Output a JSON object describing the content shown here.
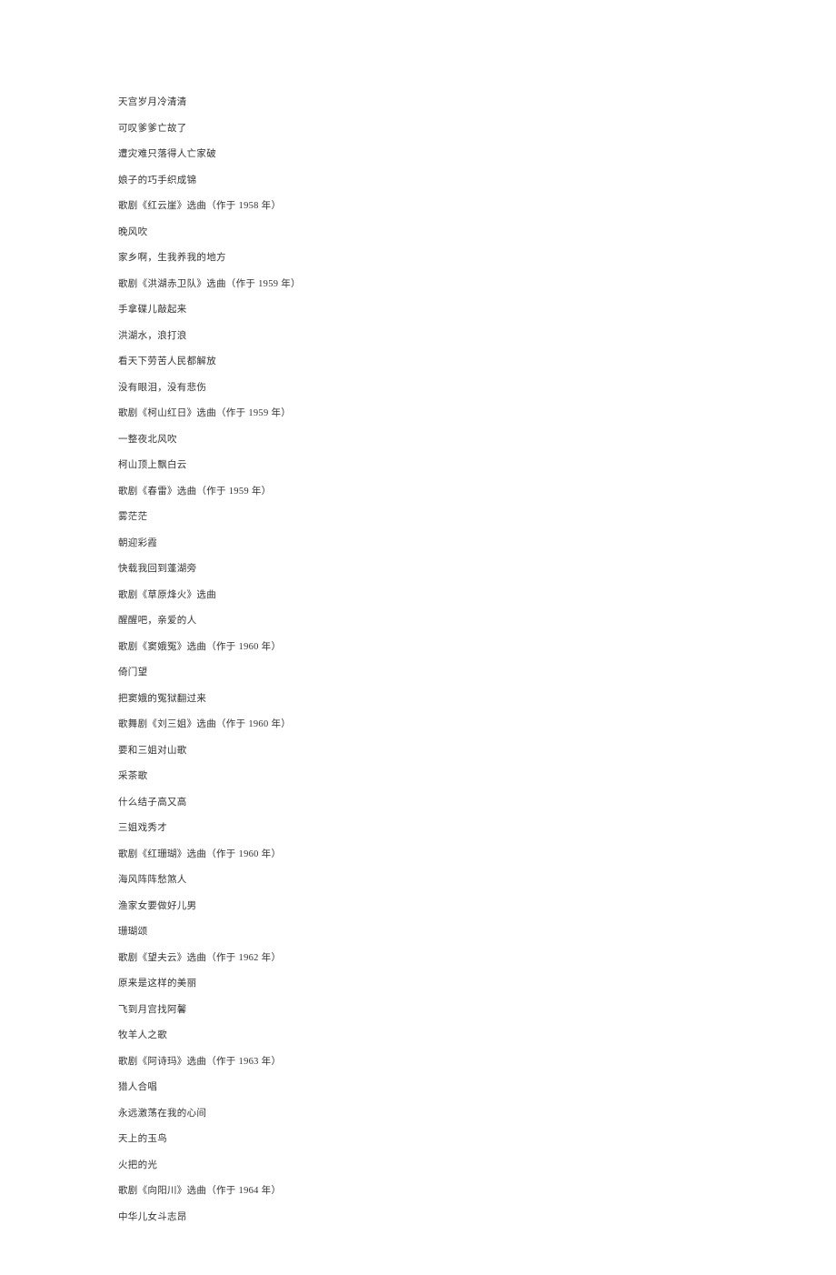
{
  "lines": [
    "天宫岁月冷清清",
    "可叹爹爹亡故了",
    "遭灾难只落得人亡家破",
    "娘子的巧手织成锦",
    "歌剧《红云崖》选曲（作于 1958 年）",
    "晚风吹",
    "家乡啊，生我养我的地方",
    "歌剧《洪湖赤卫队》选曲（作于 1959 年）",
    "手拿碟儿敲起来",
    "洪湖水，浪打浪",
    "看天下劳苦人民都解放",
    "没有眼泪，没有悲伤",
    "歌剧《柯山红日》选曲（作于 1959 年）",
    "一整夜北风吹",
    "柯山顶上飘白云",
    "歌剧《春雷》选曲（作于 1959 年）",
    "雾茫茫",
    "朝迎彩霞",
    "快载我回到蓬湖旁",
    "歌剧《草原烽火》选曲",
    "醒醒吧，亲爱的人",
    "歌剧《窦娥冤》选曲（作于 1960 年）",
    "倚门望",
    "把窦娥的冤狱翻过来",
    "歌舞剧《刘三姐》选曲（作于 1960 年）",
    "要和三姐对山歌",
    "采茶歌",
    "什么结子高又高",
    "三姐戏秀才",
    "歌剧《红珊瑚》选曲（作于 1960 年）",
    "海风阵阵愁煞人",
    "渔家女要做好儿男",
    "珊瑚颂",
    "歌剧《望夫云》选曲（作于 1962 年）",
    "原来是这样的美丽",
    "飞到月宫找阿馨",
    "牧羊人之歌",
    "歌剧《阿诗玛》选曲（作于 1963 年）",
    "猎人合唱",
    "永远激荡在我的心间",
    "天上的玉鸟",
    "火把的光",
    "歌剧《向阳川》选曲（作于 1964 年）",
    "中华儿女斗志昂"
  ]
}
